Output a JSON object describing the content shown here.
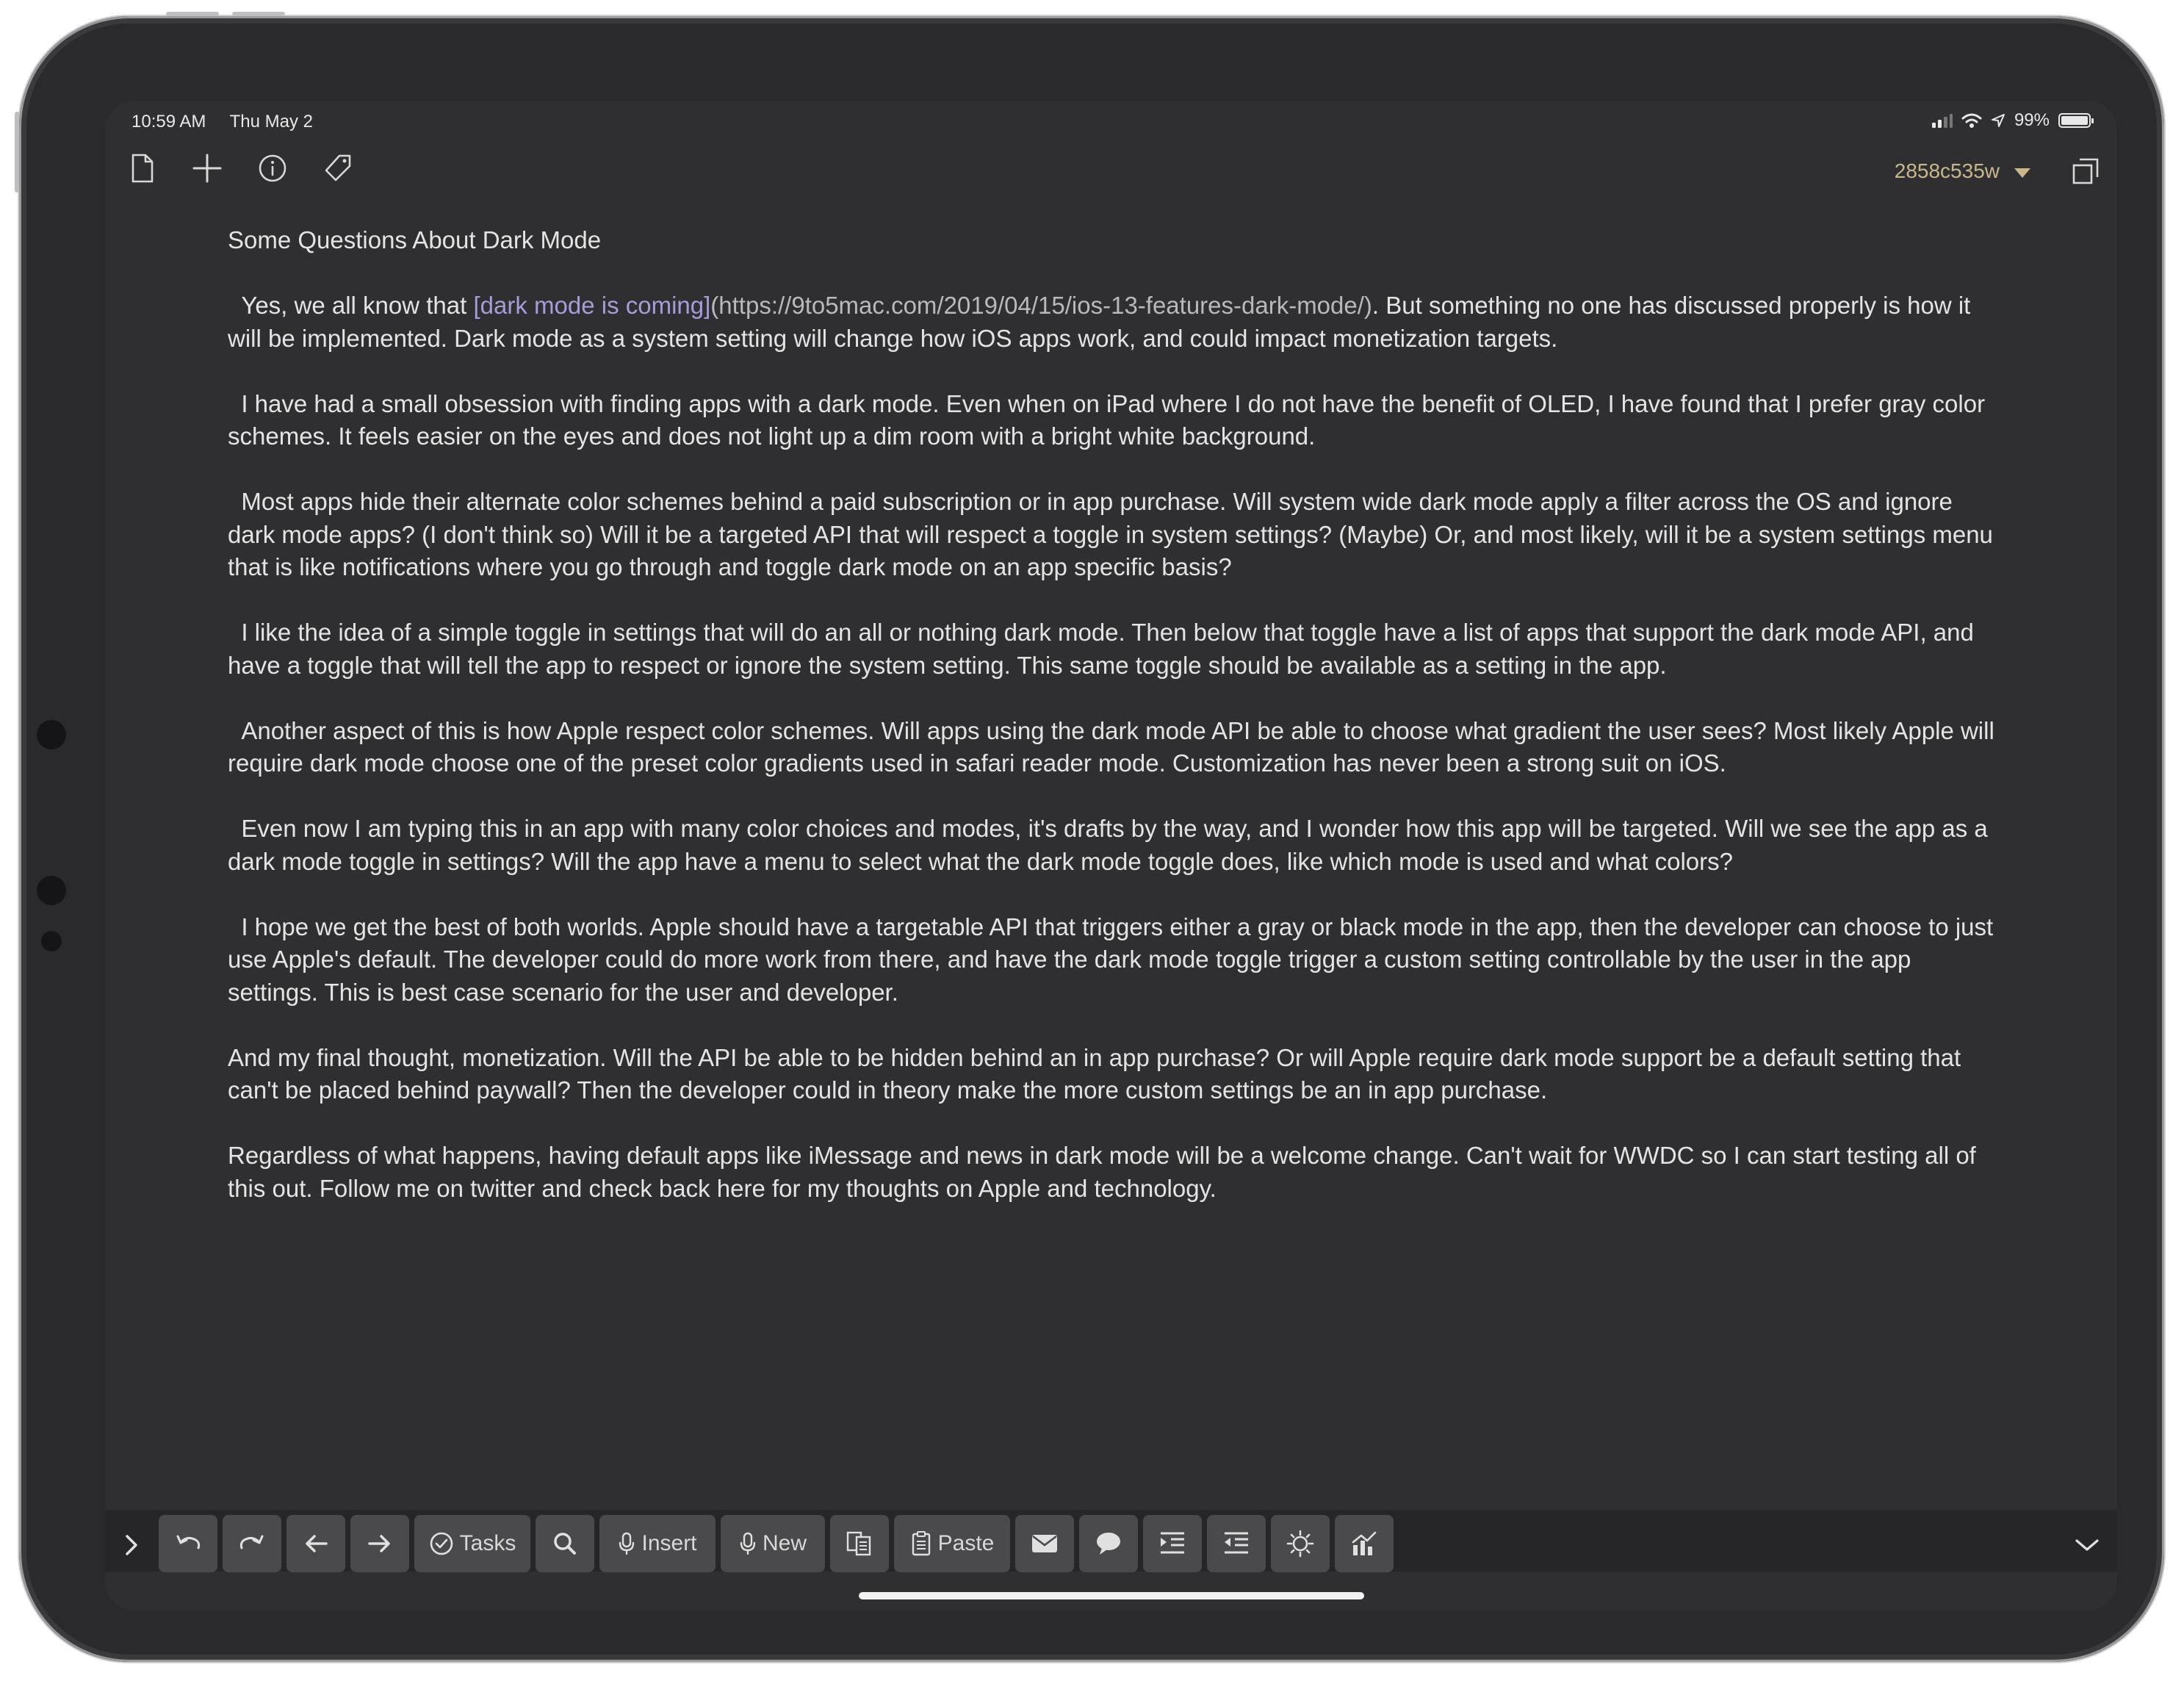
{
  "status_bar": {
    "time": "10:59 AM",
    "date": "Thu May 2",
    "battery": "99%"
  },
  "header": {
    "draft_id": "2858c535w"
  },
  "document": {
    "title": "Some Questions About Dark Mode",
    "p1_before": "  Yes, we all know that ",
    "p1_link_text": "[dark mode is coming]",
    "p1_link_url": "(https://9to5mac.com/2019/04/15/ios-13-features-dark-mode/)",
    "p1_after": ". But something no one has discussed properly is how it will be implemented. Dark mode as a system setting will change how iOS apps work, and could impact monetization targets.",
    "paragraphs": [
      "  I have had a small obsession with finding apps with a dark mode. Even when on iPad where I do not have the benefit of OLED, I have found that I prefer gray color schemes. It feels easier on the eyes and does not light up a dim room with a bright white background.",
      "  Most apps hide their alternate color schemes behind a paid subscription or in app purchase. Will system wide dark mode apply a filter across the OS and ignore dark mode apps? (I don't think so) Will it be a targeted API that will respect a toggle in system settings? (Maybe) Or, and most likely, will it be a system settings menu that is like notifications where you go through and toggle dark mode on an app specific basis?",
      "  I like the idea of a simple toggle in settings that will do an all or nothing dark mode. Then below that toggle have a list of apps that support the dark mode API, and have a toggle that will tell the app to respect or ignore the system setting. This same toggle should be available as a setting in the app.",
      "  Another aspect of this is how Apple respect color schemes. Will apps using the dark mode API be able to choose what gradient the user sees? Most likely Apple will require dark mode choose one of the preset color gradients used in safari reader mode. Customization has never been a strong suit on iOS.",
      "  Even now I am typing this in an app with many color choices and modes, it's drafts by the way, and I wonder how this app will be targeted. Will we see the app as a dark mode toggle in settings? Will the app have a menu to select what the dark mode toggle does, like which mode is used and what colors?",
      "  I hope we get the best of both worlds. Apple should have a targetable API that triggers either a gray or black mode in the app, then the developer can choose to just use Apple's default. The developer could do more work from there, and have the dark mode toggle trigger a custom setting controllable by the user in the app settings. This is best case scenario for the user and developer.",
      "And my final thought, monetization. Will the API be able to be hidden behind an in app purchase? Or will Apple require dark mode support be a default setting that can't be placed behind paywall? Then the developer could in theory make the more custom settings be an in app purchase.",
      "Regardless of what happens, having default apps like iMessage and news in dark mode will be a welcome change. Can't wait for WWDC so I can start testing all of this out. Follow me on twitter and check back here for my thoughts on Apple and technology."
    ]
  },
  "keybar": {
    "tasks": "Tasks",
    "insert": "Insert",
    "new": "New",
    "paste": "Paste"
  },
  "colors": {
    "background": "#2f2f31",
    "text": "#e4e4e4",
    "accent": "#c9b78a",
    "link": "#a89cd8",
    "key": "#4a4a4d"
  },
  "icons": [
    "document-icon",
    "plus-icon",
    "info-icon",
    "tag-icon",
    "chevron-down-icon",
    "expand-icon",
    "chevron-right-icon",
    "undo-icon",
    "redo-icon",
    "arrow-left-icon",
    "arrow-right-icon",
    "checkmark-icon",
    "search-icon",
    "mic-icon",
    "copy-icon",
    "clipboard-icon",
    "mail-icon",
    "speech-bubble-icon",
    "indent-icon",
    "outdent-icon",
    "sun-icon",
    "chart-icon"
  ]
}
